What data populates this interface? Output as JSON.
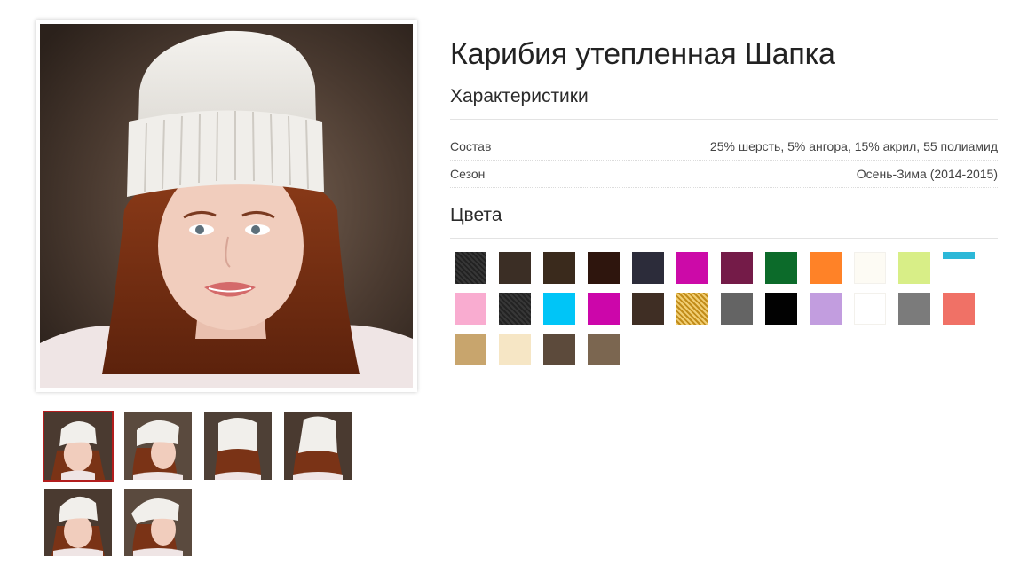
{
  "product": {
    "title": "Карибия утепленная Шапка",
    "photo_alt": "Карибия утепленная Шапка"
  },
  "characteristics": {
    "heading": "Характеристики",
    "rows": [
      {
        "label": "Состав",
        "value": "25% шерсть, 5% ангора, 15% акрил, 55 полиамид"
      },
      {
        "label": "Сезон",
        "value": "Осень-Зима (2014-2015)"
      }
    ]
  },
  "colors": {
    "heading": "Цвета",
    "swatches": [
      "#2a2a2a",
      "#3b2e25",
      "#3a2a1c",
      "#2e150d",
      "#2c2c3a",
      "#cc0aa8",
      "#741b48",
      "#0c6b2a",
      "#ff8227",
      "#fdfbf4",
      "#d8ee87",
      "#2cb8d8",
      "#f9acd0",
      "#2b2b2b",
      "#00c5f7",
      "#cc06aa",
      "#3f2e24",
      "#eab328",
      "#646464",
      "#020202",
      "#c29ddf",
      "#ffffff",
      "#7b7b7b",
      "#f07166",
      "#c8a56d",
      "#f6e6c5",
      "#5c4a3b",
      "#7b6650"
    ]
  },
  "gallery": {
    "active_index": 0,
    "thumbnail_count": 6
  }
}
